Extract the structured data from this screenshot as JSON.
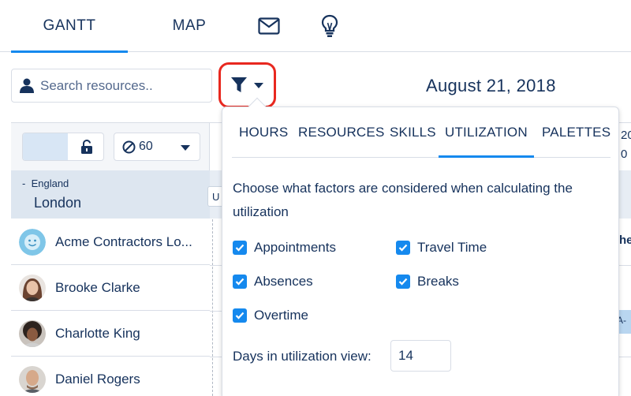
{
  "topbar": {
    "tabs": [
      {
        "label": "GANTT",
        "active": true
      },
      {
        "label": "MAP",
        "active": false
      }
    ],
    "icons": [
      "mail-icon",
      "lightbulb-icon"
    ]
  },
  "search": {
    "placeholder": "Search resources.."
  },
  "filter": {
    "icon": "filter-icon",
    "highlight_color": "#e8281f"
  },
  "date": "August 21, 2018",
  "controls": {
    "minutes_value": "60",
    "lock_icon": "unlock-icon",
    "block_icon": "no-entry-icon"
  },
  "region": {
    "collapse": "-",
    "country": "England",
    "city": "London",
    "u_label": "U"
  },
  "resources": [
    {
      "name": "Acme Contractors Lo..."
    },
    {
      "name": "Brooke Clarke"
    },
    {
      "name": "Charlotte King"
    },
    {
      "name": "Daniel Rogers"
    }
  ],
  "edge": {
    "top1": "20",
    "top2": "0",
    "row_text": "he",
    "block_text": "A-"
  },
  "popover": {
    "tabs": [
      {
        "label": "HOURS",
        "active": false
      },
      {
        "label": "RESOURCES",
        "active": false
      },
      {
        "label": "SKILLS",
        "active": false
      },
      {
        "label": "UTILIZATION",
        "active": true
      },
      {
        "label": "PALETTES",
        "active": false
      }
    ],
    "description": "Choose what factors are considered when calculating the utilization",
    "factors": [
      {
        "label": "Appointments",
        "checked": true
      },
      {
        "label": "Travel Time",
        "checked": true
      },
      {
        "label": "Absences",
        "checked": true
      },
      {
        "label": "Breaks",
        "checked": true
      },
      {
        "label": "Overtime",
        "checked": true
      }
    ],
    "days_label": "Days in utilization view:",
    "days_value": "14"
  },
  "colors": {
    "accent": "#1589ee",
    "text": "#16325c",
    "border": "#d8dde6",
    "region_bg": "#dde6f0"
  }
}
